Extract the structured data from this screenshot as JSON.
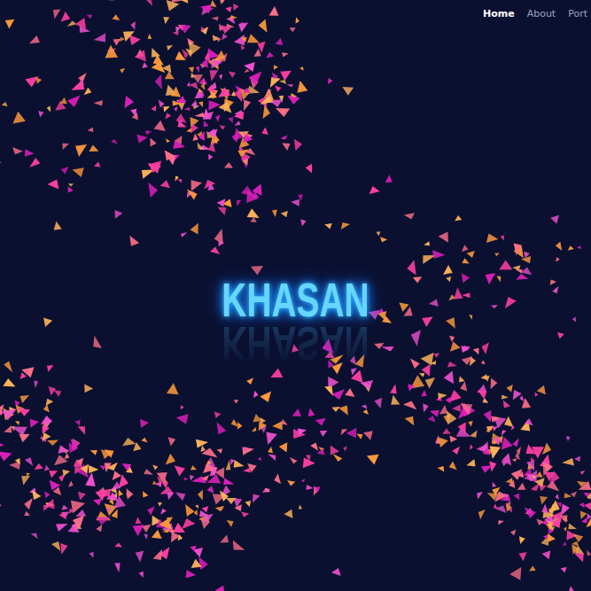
{
  "nav": {
    "items": [
      {
        "label": "Home",
        "selected": true
      },
      {
        "label": "About",
        "selected": false
      },
      {
        "label": "Port",
        "selected": false
      }
    ]
  },
  "hero": {
    "title": "KHASAN"
  }
}
